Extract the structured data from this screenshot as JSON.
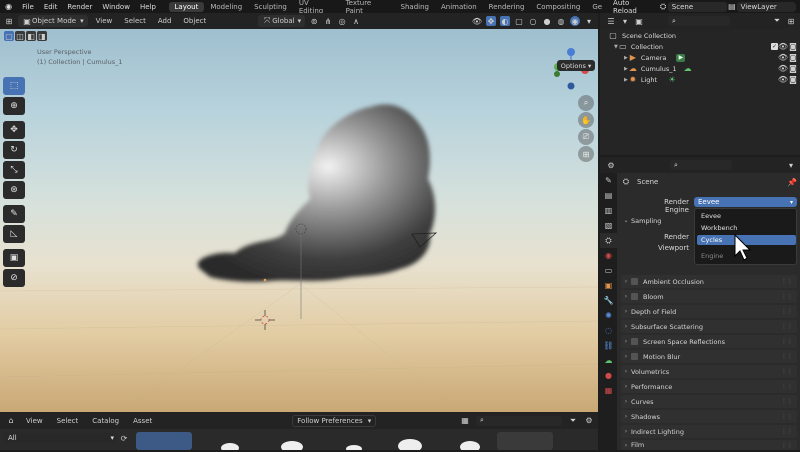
{
  "topbar": {
    "menus": [
      "File",
      "Edit",
      "Render",
      "Window",
      "Help"
    ],
    "workspaces": [
      "Layout",
      "Modeling",
      "Sculpting",
      "UV Editing",
      "Texture Paint",
      "Shading",
      "Animation",
      "Rendering",
      "Compositing",
      "Ge"
    ],
    "active_workspace": "Layout",
    "auto_reload": "Auto Reload",
    "scene": "Scene",
    "view_layer": "ViewLayer"
  },
  "viewport_header": {
    "mode": "Object Mode",
    "menus": [
      "View",
      "Select",
      "Add",
      "Object"
    ],
    "orientation": "Global",
    "options": "Options"
  },
  "viewport": {
    "view_name": "User Perspective",
    "collection_info": "(1) Collection | Cumulus_1"
  },
  "asset_browser": {
    "menus": [
      "View",
      "Select",
      "Catalog",
      "Asset"
    ],
    "preferences": "Follow Preferences",
    "library": "All"
  },
  "outliner": {
    "root": "Scene Collection",
    "collection": "Collection",
    "items": [
      "Camera",
      "Cumulus_1",
      "Light"
    ]
  },
  "properties": {
    "context": "Scene",
    "render_engine_label": "Render Engine",
    "render_engine_value": "Eevee",
    "sampling": "Sampling",
    "render_label": "Render",
    "viewport_label": "Viewport",
    "dropdown_options": [
      "Eevee",
      "Workbench",
      "Cycles"
    ],
    "dropdown_selected": "Cycles",
    "dropdown_title": "Engine",
    "panels": [
      "Ambient Occlusion",
      "Bloom",
      "Depth of Field",
      "Subsurface Scattering",
      "Screen Space Reflections",
      "Motion Blur",
      "Volumetrics",
      "Performance",
      "Curves",
      "Shadows",
      "Indirect Lighting",
      "Film"
    ]
  },
  "colors": {
    "accent_blue": "#4772b3",
    "selected_item": "#3d6fb8"
  }
}
